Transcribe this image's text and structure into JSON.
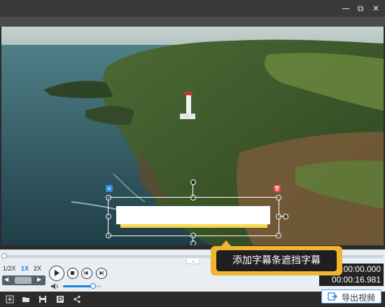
{
  "window": {
    "minimize": "—",
    "restore": "⧉",
    "close": "✕"
  },
  "subtitle_box": {
    "list_icon": "≡",
    "delete_icon": "🗑"
  },
  "hint": {
    "text": "添加字幕条遮挡字幕"
  },
  "speed": {
    "half": "1/2X",
    "normal": "1X",
    "double": "2X",
    "selected": "1X"
  },
  "volume": {
    "level": 0.78
  },
  "timeline": {
    "progress": 0.005
  },
  "time": {
    "current": "00:00:00.000",
    "total": "00:00:16.981"
  },
  "export": {
    "label": "导出视频"
  },
  "colors": {
    "accent": "#1e7fd9",
    "hint_border": "#f0b531",
    "subtitle_bar": "#f5d84e",
    "delete_tag": "#e84545",
    "list_tag": "#2a8ee0"
  }
}
